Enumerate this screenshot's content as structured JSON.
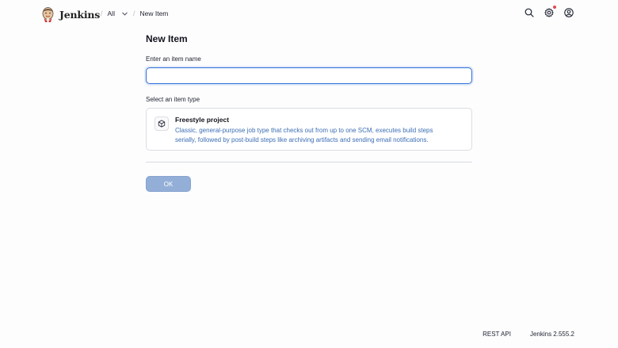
{
  "header": {
    "brand_name": "Jenkins",
    "breadcrumbs": [
      "All",
      "New Item"
    ],
    "icons": {
      "logo": "jenkins-butler-logo",
      "search": "search-icon",
      "settings": "gear-icon",
      "account": "user-circle-icon",
      "notification": "notification-dot"
    },
    "notification_color": "#e5484d"
  },
  "main": {
    "title": "New Item",
    "name_label": "Enter an item name",
    "name_value": "",
    "type_label": "Select an item type",
    "item_types": [
      {
        "title": "Freestyle project",
        "description": "Classic, general-purpose job type that checks out from up to one SCM, executes build steps serially, followed by post-build steps like archiving artifacts and sending email notifications.",
        "icon": "cube-icon"
      }
    ],
    "ok_label": "OK"
  },
  "footer": {
    "rest_api": "REST API",
    "version": "Jenkins 2.555.2"
  },
  "colors": {
    "accent": "#2f6fd6",
    "link_text": "#3c6eb5",
    "ok_button_disabled": "#93afd8"
  }
}
